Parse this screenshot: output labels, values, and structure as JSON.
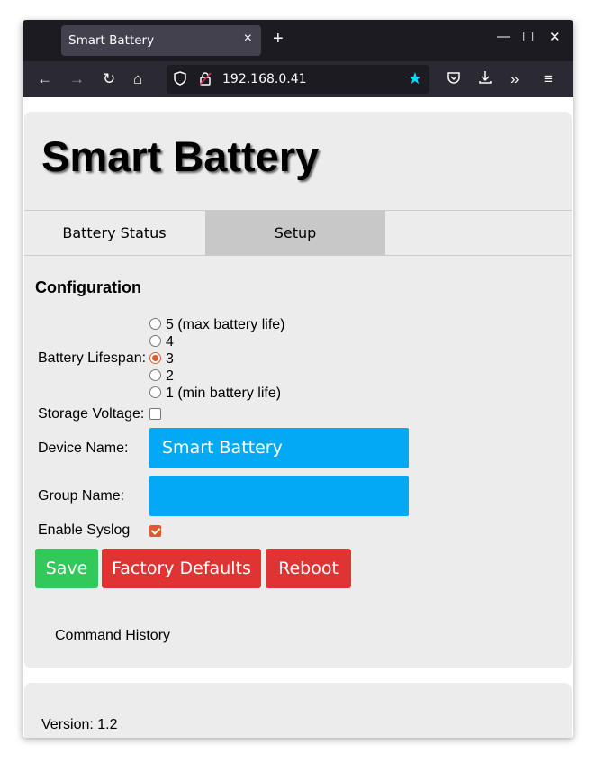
{
  "browser": {
    "tab_title": "Smart Battery",
    "tab_close": "×",
    "new_tab": "+",
    "window_controls": {
      "minimize": "—",
      "maximize": "☐",
      "close": "✕"
    },
    "nav": {
      "back": "←",
      "forward": "→",
      "reload": "↻",
      "home": "⌂",
      "more_tools": "»",
      "menu": "≡"
    },
    "url": "192.168.0.41",
    "bookmark_star": "★"
  },
  "page": {
    "title": "Smart Battery",
    "tabs": [
      {
        "label": "Battery Status",
        "active": false
      },
      {
        "label": "Setup",
        "active": true
      }
    ],
    "section_title": "Configuration",
    "lifespan": {
      "label": "Battery Lifespan:",
      "options": [
        {
          "label": "5 (max battery life)",
          "checked": false
        },
        {
          "label": "4",
          "checked": false
        },
        {
          "label": "3",
          "checked": true
        },
        {
          "label": "2",
          "checked": false
        },
        {
          "label": "1 (min battery life)",
          "checked": false
        }
      ]
    },
    "storage_voltage": {
      "label": "Storage Voltage:",
      "checked": false
    },
    "device_name": {
      "label": "Device Name:",
      "value": "Smart Battery"
    },
    "group_name": {
      "label": "Group Name:",
      "value": ""
    },
    "syslog": {
      "label": "Enable Syslog",
      "checked": true
    },
    "buttons": {
      "save": "Save",
      "factory_defaults": "Factory Defaults",
      "reboot": "Reboot"
    },
    "command_history": "Command History",
    "version": "Version: 1.2"
  },
  "colors": {
    "input_bg": "#03a9f4",
    "save_button": "#32c85a",
    "danger_button": "#e03333",
    "accent_checked": "#e05a2b",
    "active_tab": "#c8c8c8"
  }
}
